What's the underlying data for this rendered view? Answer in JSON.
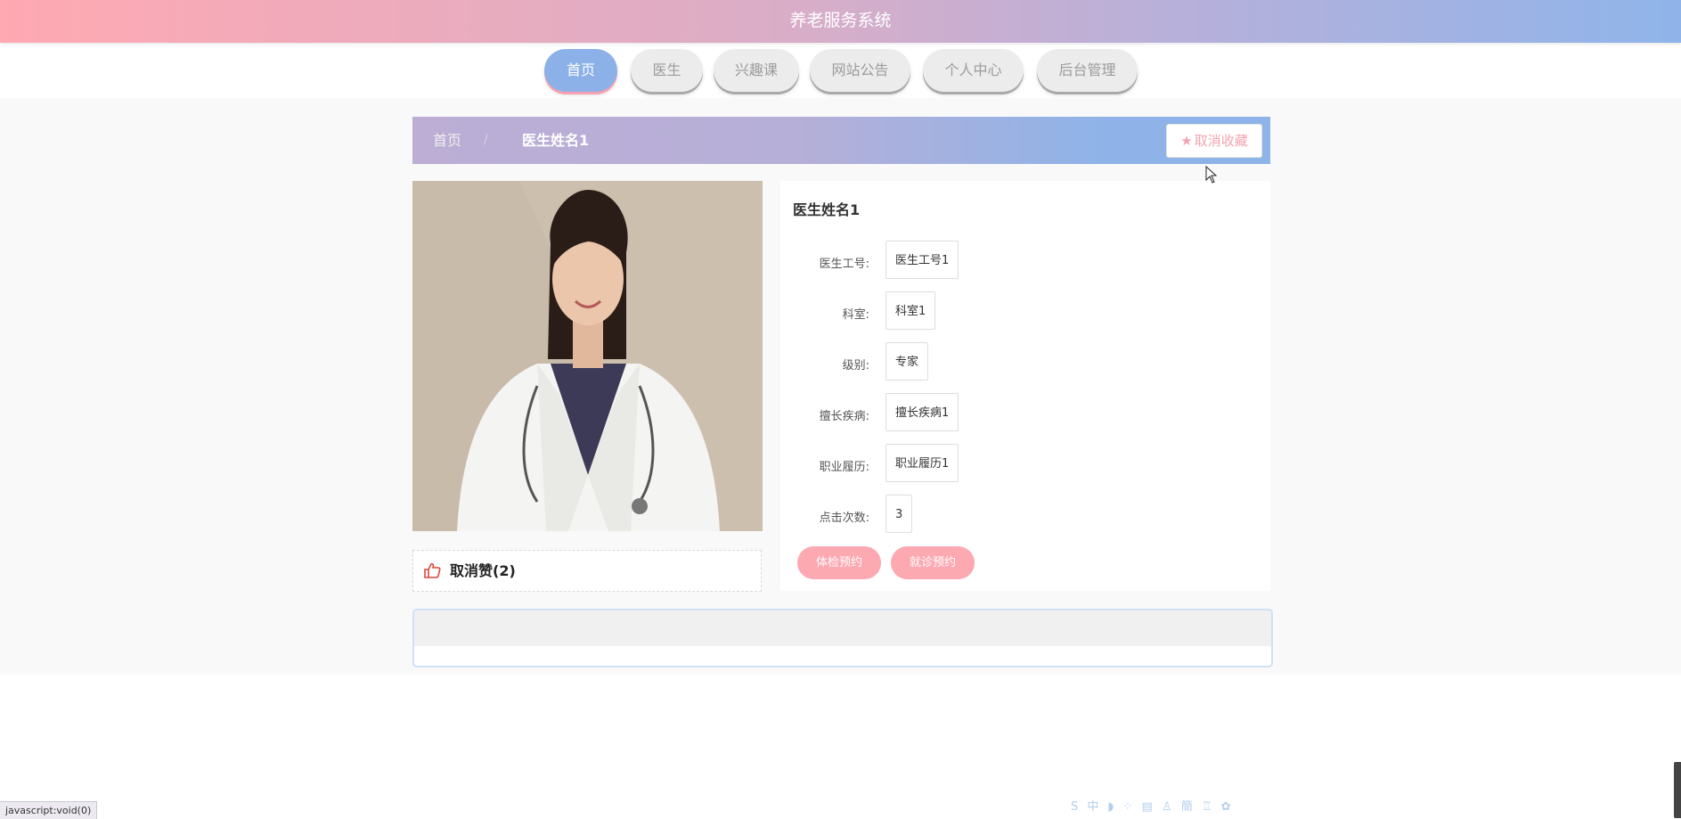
{
  "app": {
    "title": "养老服务系统"
  },
  "nav": {
    "items": [
      {
        "label": "首页",
        "active": true
      },
      {
        "label": "医生",
        "active": false
      },
      {
        "label": "兴趣课",
        "active": false
      },
      {
        "label": "网站公告",
        "active": false
      },
      {
        "label": "个人中心",
        "active": false
      },
      {
        "label": "后台管理",
        "active": false
      }
    ]
  },
  "breadcrumb": {
    "home": "首页",
    "separator": "/",
    "current": "医生姓名1"
  },
  "favorite": {
    "label": "取消收藏",
    "icon": "star-icon"
  },
  "doctor": {
    "name": "医生姓名1",
    "fields": [
      {
        "label": "医生工号:",
        "value": "医生工号1"
      },
      {
        "label": "科室:",
        "value": "科室1"
      },
      {
        "label": "级别:",
        "value": "专家"
      },
      {
        "label": "擅长疾病:",
        "value": "擅长疾病1"
      },
      {
        "label": "职业履历:",
        "value": "职业履历1"
      },
      {
        "label": "点击次数:",
        "value": "3"
      }
    ]
  },
  "like": {
    "label": "取消赞(2)",
    "icon": "thumbs-up-icon"
  },
  "actions": {
    "checkup": "体检预约",
    "visit": "就诊预约"
  },
  "statusbar": {
    "text": "javascript:void(0)"
  },
  "ime": {
    "text": "S 中 ◗ ⁘ ▤ ♙ 簡 ♖ ✿"
  },
  "colors": {
    "accent_blue": "#8cb1e8",
    "accent_pink": "#fda9b1",
    "header_start": "#ffa9b2",
    "header_end": "#8fb4ea"
  }
}
